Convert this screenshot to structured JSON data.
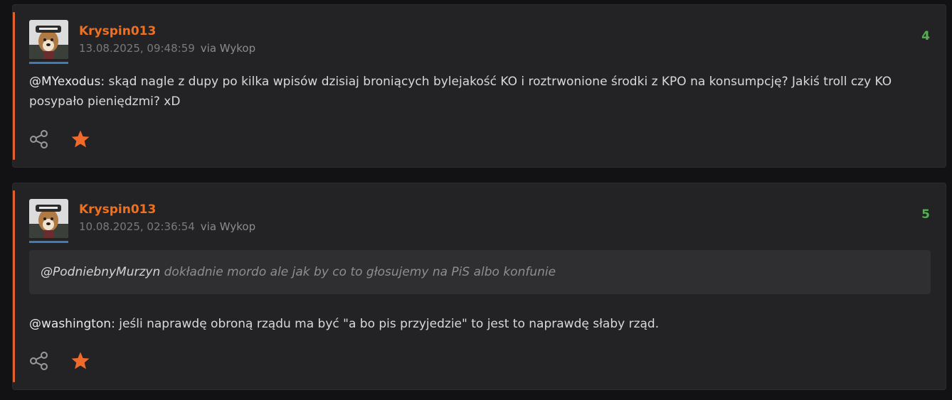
{
  "comments": [
    {
      "author": "Kryspin013",
      "date": "13.08.2025, 09:48:59",
      "via": "via Wykop",
      "votes": "4",
      "mention": "@MYexodus",
      "text": ": skąd nagle z dupy po kilka wpisów dzisiaj broniących bylejakość KO i roztrwonione środki z KPO na konsumpcję? Jakiś troll czy KO posypało pieniędzmi? xD",
      "share_icon": "share-icon",
      "favorite_icon": "star-icon"
    },
    {
      "author": "Kryspin013",
      "date": "10.08.2025, 02:36:54",
      "via": "via Wykop",
      "votes": "5",
      "quote_mention": "@PodniebnyMurzyn",
      "quote_text": " dokładnie mordo ale jak by co to głosujemy na PiS albo konfunie",
      "mention": "@washington",
      "text": ": jeśli naprawdę obroną rządu ma być \"a bo pis przyjedzie\" to jest to naprawdę słaby rząd.",
      "share_icon": "share-icon",
      "favorite_icon": "star-icon"
    }
  ],
  "colors": {
    "background": "#121214",
    "card": "#232325",
    "accent": "#e2602a",
    "author": "#f07020",
    "votes": "#54b04f",
    "avatar_underline": "#3d7cb8"
  }
}
